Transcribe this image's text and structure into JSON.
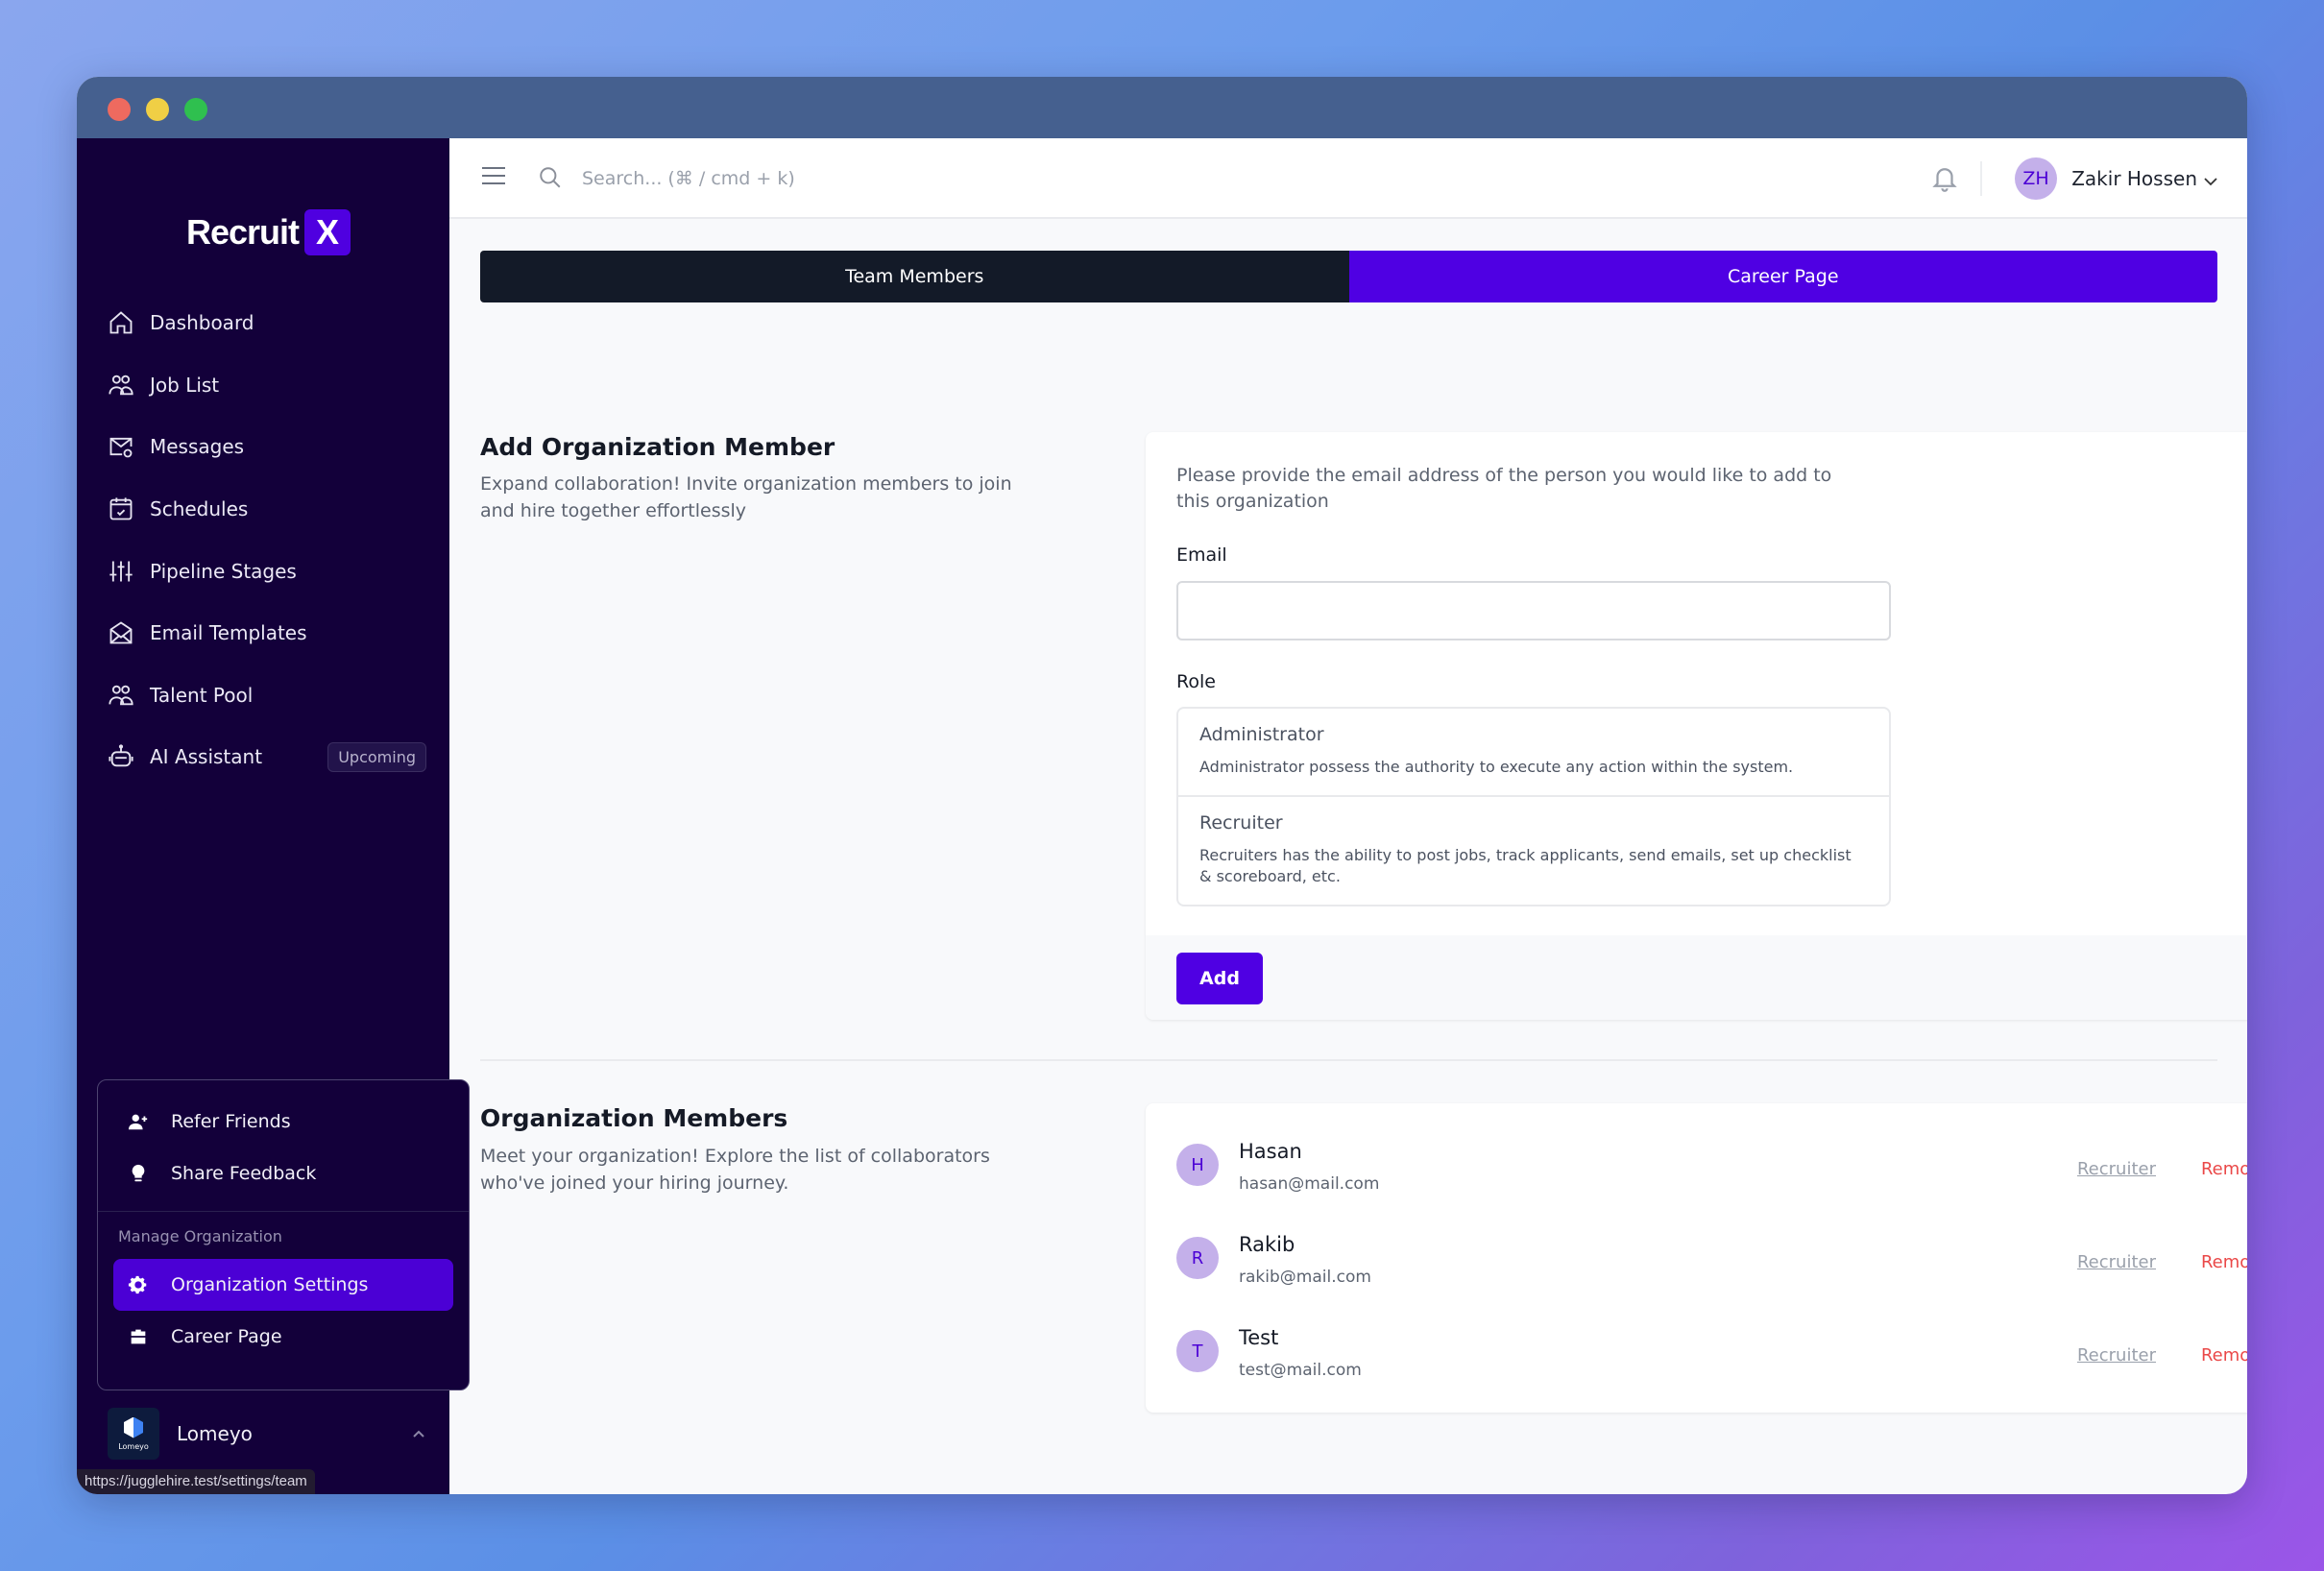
{
  "window": {
    "controls": [
      "close",
      "minimize",
      "maximize"
    ]
  },
  "brand": {
    "name": "Recruit",
    "mark": "X",
    "accent": "#4f00e3"
  },
  "sidebar": {
    "items": [
      {
        "label": "Dashboard",
        "icon": "home-icon"
      },
      {
        "label": "Job List",
        "icon": "users-icon"
      },
      {
        "label": "Messages",
        "icon": "mail-at-icon"
      },
      {
        "label": "Schedules",
        "icon": "calendar-check-icon"
      },
      {
        "label": "Pipeline Stages",
        "icon": "sliders-icon"
      },
      {
        "label": "Email Templates",
        "icon": "envelope-open-icon"
      },
      {
        "label": "Talent Pool",
        "icon": "users-icon"
      },
      {
        "label": "AI Assistant",
        "icon": "robot-icon",
        "badge": "Upcoming"
      }
    ]
  },
  "popup": {
    "items": [
      {
        "label": "Refer Friends",
        "icon": "user-plus-icon"
      },
      {
        "label": "Share Feedback",
        "icon": "lightbulb-icon"
      }
    ],
    "section_label": "Manage Organization",
    "org_items": [
      {
        "label": "Organization Settings",
        "icon": "gear-icon",
        "active": true
      },
      {
        "label": "Career Page",
        "icon": "briefcase-icon",
        "active": false
      }
    ]
  },
  "org": {
    "name": "Lomeyo",
    "logo_text": "Lomeyo"
  },
  "status_url": "https://jugglehire.test/settings/team",
  "header": {
    "search_placeholder": "Search... (⌘ / cmd + k)",
    "user_initials": "ZH",
    "user_name": "Zakir Hossen"
  },
  "tabs": [
    {
      "label": "Team Members",
      "active": false
    },
    {
      "label": "Career Page",
      "active": true
    }
  ],
  "add_member": {
    "title": "Add Organization Member",
    "description": "Expand collaboration! Invite organization members to join and hire together effortlessly",
    "intro": "Please provide the email address of the person you would like to add to this organization",
    "email_label": "Email",
    "email_value": "",
    "role_label": "Role",
    "roles": [
      {
        "title": "Administrator",
        "description": "Administrator possess the authority to execute any action within the system."
      },
      {
        "title": "Recruiter",
        "description": "Recruiters has the ability to post jobs, track applicants, send emails, set up checklist & scoreboard, etc."
      }
    ],
    "add_button": "Add"
  },
  "members_section": {
    "title": "Organization Members",
    "description": "Meet your organization! Explore the list of collaborators who've joined your hiring journey.",
    "members": [
      {
        "initial": "H",
        "name": "Hasan",
        "email": "hasan@mail.com",
        "role": "Recruiter",
        "remove": "Remove"
      },
      {
        "initial": "R",
        "name": "Rakib",
        "email": "rakib@mail.com",
        "role": "Recruiter",
        "remove": "Remove"
      },
      {
        "initial": "T",
        "name": "Test",
        "email": "test@mail.com",
        "role": "Recruiter",
        "remove": "Remove"
      }
    ]
  }
}
